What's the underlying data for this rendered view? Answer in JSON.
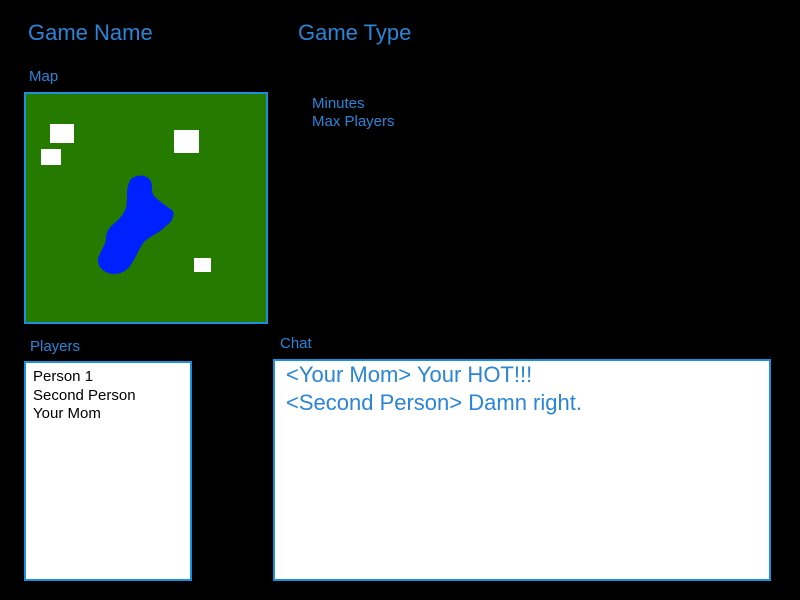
{
  "header": {
    "game_name": "Game Name",
    "game_type": "Game Type"
  },
  "settings": {
    "minutes_label": "Minutes",
    "max_players_label": "Max Players"
  },
  "map": {
    "label": "Map",
    "colors": {
      "grass": "#247b00",
      "water": "#0021ff",
      "building": "#ffffff",
      "border": "#1a8fe0"
    }
  },
  "players": {
    "label": "Players",
    "items": [
      "Person 1",
      "Second Person",
      "Your Mom"
    ]
  },
  "chat": {
    "label": "Chat",
    "messages": [
      "<Your Mom> Your HOT!!!",
      "<Second Person> Damn right."
    ]
  },
  "colors": {
    "background": "#000000",
    "accent_text": "#2a85d8",
    "panel_border": "#1a8fe0",
    "panel_background": "#ffffff"
  }
}
